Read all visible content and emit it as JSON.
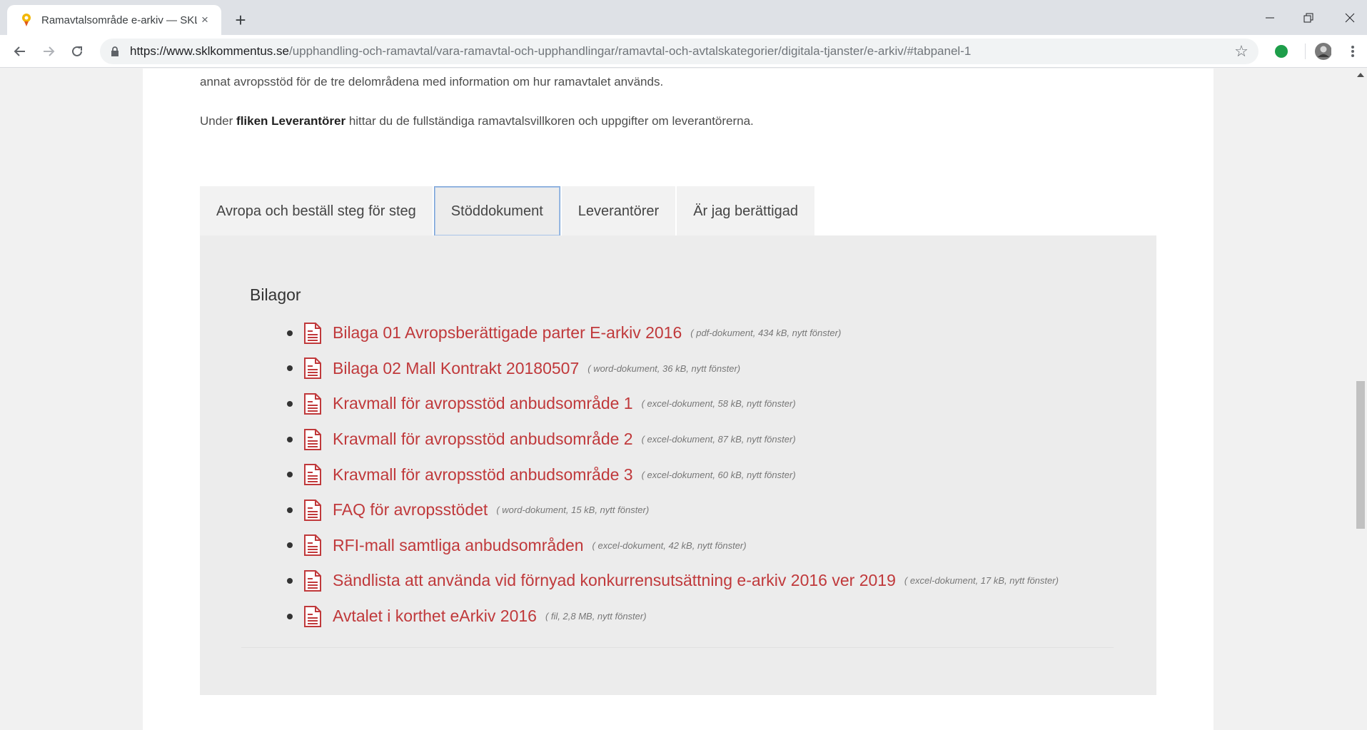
{
  "browser": {
    "tab_title": "Ramavtalsområde e-arkiv — SKL",
    "new_tab_label": "+",
    "tab_close_label": "×",
    "url_host": "https://www.sklkommentus.se",
    "url_path": "/upphandling-och-ramavtal/vara-ramavtal-och-upphandlingar/ramavtal-och-avtalskategorier/digitala-tjanster/e-arkiv/#tabpanel-1"
  },
  "intro": {
    "line1": "annat avropsstöd för de tre delområdena med information om hur ramavtalet används.",
    "line2_prefix": "Under ",
    "line2_bold": "fliken Leverantörer",
    "line2_suffix": " hittar du de fullständiga ramavtalsvillkoren och uppgifter om leverantörerna."
  },
  "tabs": [
    {
      "label": "Avropa och beställ steg för steg"
    },
    {
      "label": "Stöddokument"
    },
    {
      "label": "Leverantörer"
    },
    {
      "label": "Är jag berättigad"
    }
  ],
  "panel": {
    "heading": "Bilagor",
    "documents": [
      {
        "title": "Bilaga 01 Avropsberättigade parter E-arkiv 2016",
        "meta": "( pdf-dokument, 434 kB, nytt fönster)"
      },
      {
        "title": "Bilaga 02 Mall Kontrakt 20180507",
        "meta": "( word-dokument, 36 kB, nytt fönster)"
      },
      {
        "title": "Kravmall för avropsstöd anbudsområde 1",
        "meta": "( excel-dokument, 58 kB, nytt fönster)"
      },
      {
        "title": "Kravmall för avropsstöd anbudsområde 2",
        "meta": "( excel-dokument, 87 kB, nytt fönster)"
      },
      {
        "title": "Kravmall för avropsstöd anbudsområde 3",
        "meta": "( excel-dokument, 60 kB, nytt fönster)"
      },
      {
        "title": "FAQ för avropsstödet",
        "meta": "( word-dokument, 15 kB, nytt fönster)"
      },
      {
        "title": "RFI-mall samtliga anbudsområden",
        "meta": "( excel-dokument, 42 kB, nytt fönster)"
      },
      {
        "title": "Sändlista att använda vid förnyad konkurrensutsättning e-arkiv 2016 ver 2019",
        "meta": "( excel-dokument, 17 kB, nytt fönster)"
      },
      {
        "title": "Avtalet i korthet eArkiv 2016",
        "meta": "( fil, 2,8 MB, nytt fönster)"
      }
    ]
  },
  "colors": {
    "link": "#c0393b",
    "tab_active_border": "#7aa3d6",
    "panel_bg": "#ececec"
  }
}
